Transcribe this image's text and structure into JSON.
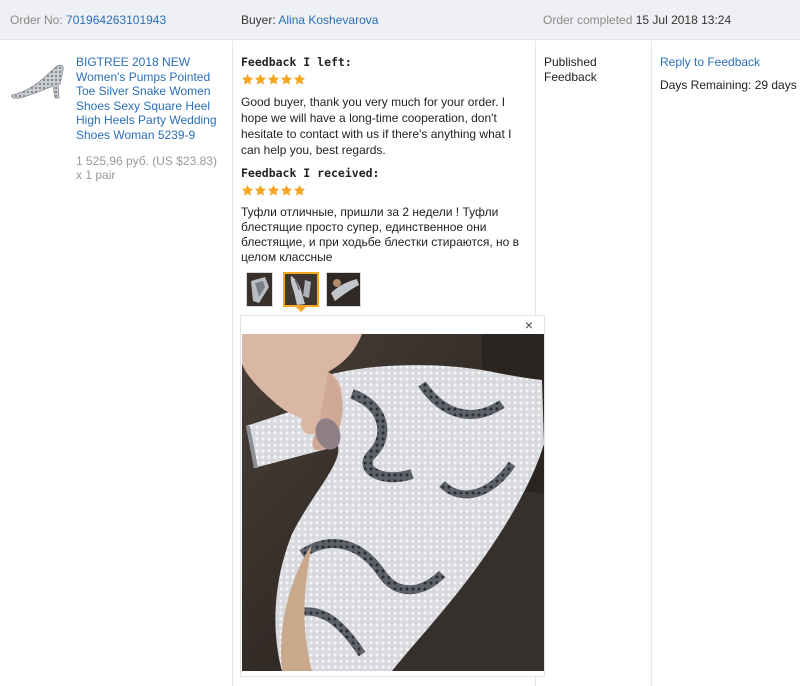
{
  "order": {
    "order_no_label": "Order No:",
    "order_no": "701964263101943",
    "buyer_label": "Buyer:",
    "buyer_name": "Alina Koshevarova",
    "status_label": "Order completed",
    "completed_date": "15 Jul 2018 13:24"
  },
  "product": {
    "title": "BIGTREE 2018 NEW Women's Pumps Pointed Toe Silver Snake Women Shoes Sexy Square Heel High Heels Party Wedding Shoes Woman 5239-9",
    "price": "1 525,96 руб. (US $23.83)",
    "quantity": "x 1 pair"
  },
  "feedback_left": {
    "heading": "Feedback I left:",
    "rating": 5,
    "text": "Good buyer, thank you very much for your order. I hope we will have a long-time cooperation, don't hesitate to contact with us if there's anything what I can help you, best regards."
  },
  "feedback_received": {
    "heading": "Feedback I received:",
    "rating": 5,
    "text": "Туфли отличные, пришли за 2 недели ! Туфли блестящие просто супер, единственное они блестящие, и при ходьбе блестки стираются, но в целом классные",
    "photo_count": 3,
    "active_photo": 2
  },
  "viewer": {
    "close_glyph": "×"
  },
  "status": {
    "text": "Published Feedback"
  },
  "actions": {
    "reply_label": "Reply to Feedback",
    "days_remaining": "Days Remaining: 29 days"
  },
  "colors": {
    "link": "#2a6fb8",
    "star": "#f5a623",
    "header_bg": "#eef0f3"
  },
  "icons": {
    "star": "star-icon",
    "close": "close-icon"
  }
}
